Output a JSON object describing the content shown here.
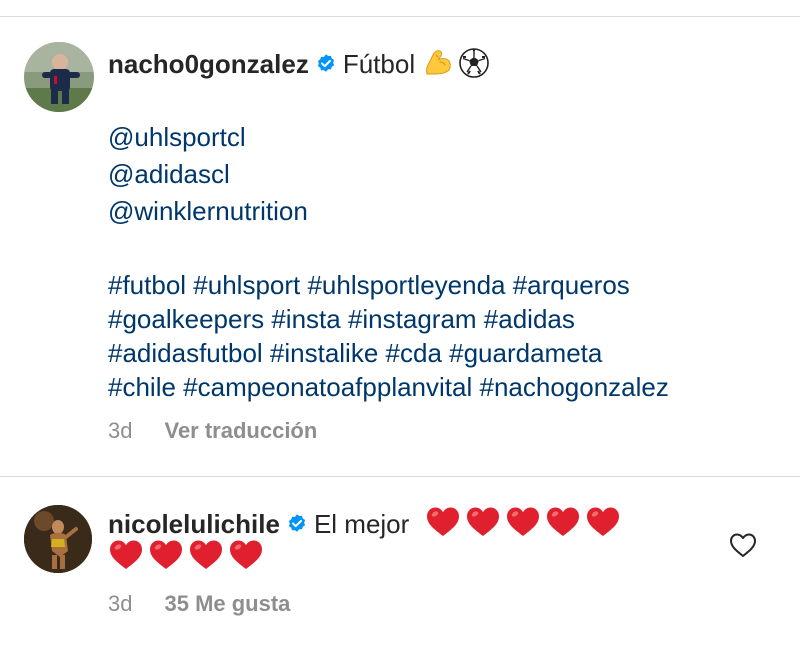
{
  "comments": [
    {
      "username": "nacho0gonzalez",
      "verified": true,
      "caption_first": "Fútbol",
      "caption_emojis": [
        "flexed-biceps",
        "soccer-ball"
      ],
      "mentions": [
        "@uhlsportcl",
        "@adidascl",
        "@winklernutrition"
      ],
      "hashtag_lines": [
        "#futbol #uhlsport #uhlsportleyenda #arqueros",
        "#goalkeepers #insta #instagram #adidas",
        "#adidasfutbol #instalike  #cda #guardameta",
        "#chile #campeonatoafpplanvital #nachogonzalez"
      ],
      "time": "3d",
      "action": "Ver traducción"
    },
    {
      "username": "nicolelulichile",
      "verified": true,
      "text": "El mejor",
      "hearts_line1": 5,
      "hearts_line2": 4,
      "time": "3d",
      "likes": "35 Me gusta"
    }
  ],
  "colors": {
    "text": "#262626",
    "link": "#00376b",
    "secondary": "#8e8e8e",
    "verified": "#0095f6",
    "divider": "#dbdbdb",
    "heart": "#e0202e"
  },
  "icons": [
    "verified-badge-icon",
    "flexed-biceps-emoji",
    "soccer-ball-emoji",
    "red-heart-emoji",
    "heart-outline-icon"
  ]
}
